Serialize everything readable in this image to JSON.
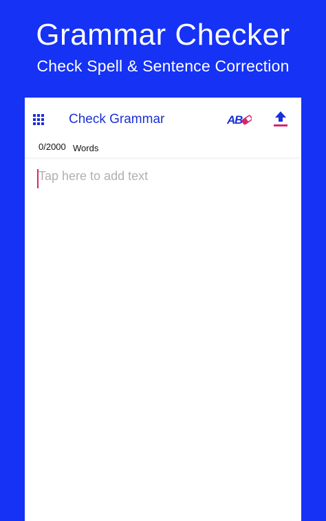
{
  "hero": {
    "title": "Grammar Checker",
    "subtitle": "Check Spell & Sentence Correction"
  },
  "toolbar": {
    "menu_icon": "grid-icon",
    "title": "Check Grammar",
    "abc_icon": "abc-eraser-icon",
    "upload_icon": "upload-icon"
  },
  "counter": {
    "value": "0/2000",
    "unit": "Words"
  },
  "editor": {
    "placeholder": "Tap here to add text",
    "value": ""
  },
  "colors": {
    "background": "#1532F5",
    "accent_blue": "#1a2fd6",
    "accent_pink": "#d6246e"
  }
}
